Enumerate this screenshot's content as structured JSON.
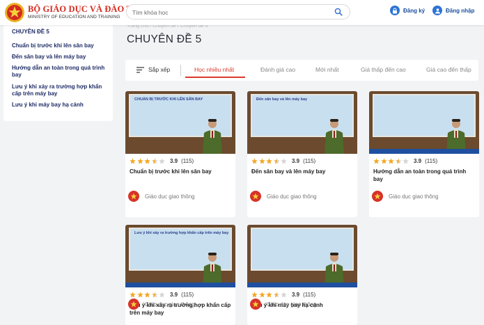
{
  "header": {
    "brand_title": "BỘ GIÁO DỤC VÀ ĐÀO TẠO",
    "brand_subtitle": "MINISTRY OF EDUCATION AND TRAINING",
    "search_placeholder": "Tìm khóa học",
    "register_label": "Đăng ký",
    "login_label": "Đăng nhập"
  },
  "sidebar": {
    "title": "CHUYÊN ĐỀ 5",
    "items": [
      "Chuẩn bị trước khi lên sân bay",
      "Đến sân bay và lên máy bay",
      "Hướng dẫn an toàn trong quá trình bay",
      "Lưu ý khi xảy ra trường hợp khẩn cấp trên máy bay",
      "Lưu ý khi máy bay hạ cánh"
    ]
  },
  "main": {
    "breadcrumb": "Trang chủ  /  Chuyên đề  /  Chuyên đề 5",
    "title": "CHUYÊN ĐỀ 5",
    "sort_label": "Sắp xếp",
    "tabs": [
      "Học nhiều nhất",
      "Đánh giá cao",
      "Mới nhất",
      "Giá thấp đến cao",
      "Giá cao đến thấp"
    ],
    "active_tab": 0
  },
  "courses": [
    {
      "title": "Chuẩn bị trước khi lên sân bay",
      "rating": "3.9",
      "count": "(115)",
      "stars": 3.5,
      "publisher": "Giáo dục giao thông",
      "board_text": "CHUẨN BỊ TRƯỚC KHI LÊN SÂN BAY"
    },
    {
      "title": "Đến sân bay và lên máy bay",
      "rating": "3.9",
      "count": "(115)",
      "stars": 3.5,
      "publisher": "Giáo dục giao thông",
      "board_text": "Đến sân bay và lên máy bay"
    },
    {
      "title": "Hướng dẫn an toàn trong quá trình bay",
      "rating": "3.9",
      "count": "(115)",
      "stars": 3.5,
      "publisher": "Giáo dục giao thông",
      "board_text": ""
    },
    {
      "title": "Lưu ý khi xảy ra trường hợp khẩn cấp trên máy bay",
      "rating": "3.9",
      "count": "(115)",
      "stars": 3.5,
      "publisher": "Giáo dục giao thông",
      "board_text": "Lưu ý khi xảy ra trường hợp khẩn cấp trên máy bay"
    },
    {
      "title": "Lưu ý khi máy bay hạ cánh",
      "rating": "3.9",
      "count": "(115)",
      "stars": 3.5,
      "publisher": "Giáo dục giao thông",
      "board_text": ""
    }
  ],
  "colors": {
    "accent": "#d83a2c",
    "star": "#f5a623",
    "star_empty": "#d4d4d4",
    "nav_text": "#1f2c66",
    "link_blue": "#1a4f9c"
  }
}
